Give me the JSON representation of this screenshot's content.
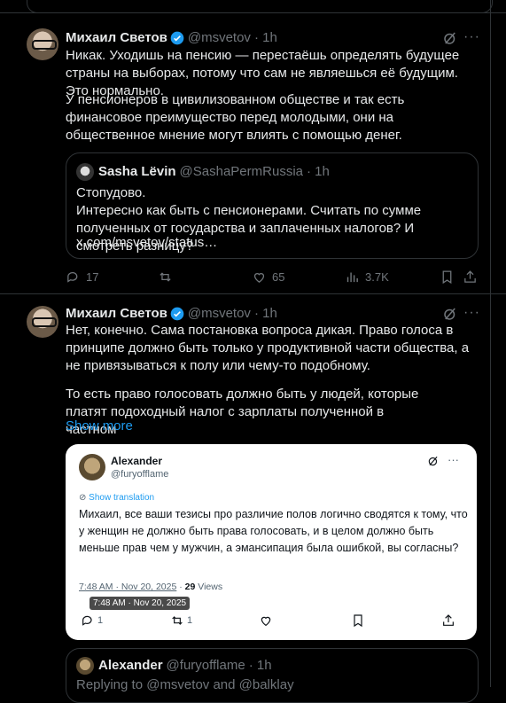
{
  "post1": {
    "author": "Михаил Светов",
    "handle": "@msvetov",
    "time": "· 1h",
    "para1": "Никак. Уходишь на пенсию — перестаёшь определять будущее страны на выборах, потому что сам не являешься её будущим. Это нормально.",
    "para2": "У пенсионеров в цивилизованном обществе и так есть финансовое преимущество перед молодыми, они на общественное мнение могут влиять с помощью денег.",
    "quote": {
      "author": "Sasha Lëvin",
      "handle": "@SashaPermRussia",
      "time": "· 1h",
      "line1": "Стопудово.",
      "line2": "Интересно как быть с пенсионерами. Считать по сумме полученных от государства и заплаченных налогов? И смотреть разницу?",
      "link": "x.com/msvetov/status…"
    },
    "actions": {
      "replies": "17",
      "likes": "65",
      "views": "3.7K"
    }
  },
  "post2": {
    "author": "Михаил Светов",
    "handle": "@msvetov",
    "time": "· 1h",
    "para1": "Нет, конечно. Сама постановка вопроса дикая. Право голоса в принципе должно быть только у продуктивной части общества, а не привязываться к полу или чему-то подобному.",
    "para2": "То есть право голосовать должно быть у людей, которые платят подоходный налог с зарплаты полученной в частном",
    "show_more": "Show more",
    "card": {
      "author": "Alexander",
      "handle": "@furyofflame",
      "show_translation": "Show translation",
      "body": "Михаил, все ваши тезисы про различие полов логично сводятся к тому, что у женщин не должно быть права голосовать, и в целом должно быть меньше прав чем у мужчин, а эмансипация была ошибкой, вы согласны?",
      "timestamp": "7:48 AM · Nov 20, 2025",
      "views_sep": " · ",
      "views_count": "29",
      "views_label": " Views",
      "tooltip": "7:48 AM · Nov 20, 2025",
      "replies": "1",
      "reposts": "1"
    },
    "quote2": {
      "author": "Alexander",
      "handle": "@furyofflame",
      "time": "· 1h",
      "replying": "Replying to @msvetov and @balklay"
    }
  },
  "colors": {
    "accent": "#1d9bf0",
    "muted": "#71767b",
    "border": "#2f3336"
  }
}
